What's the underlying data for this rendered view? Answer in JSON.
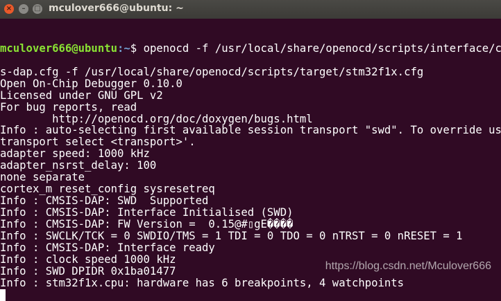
{
  "window": {
    "title": "mculover666@ubuntu: ~"
  },
  "prompt": {
    "user_host": "mculover666@ubuntu",
    "path": ":~",
    "symbol": "$ ",
    "command": "openocd -f /usr/local/share/openocd/scripts/interface/cmsi"
  },
  "lines": [
    "s-dap.cfg -f /usr/local/share/openocd/scripts/target/stm32f1x.cfg",
    "Open On-Chip Debugger 0.10.0",
    "Licensed under GNU GPL v2",
    "For bug reports, read",
    "        http://openocd.org/doc/doxygen/bugs.html",
    "Info : auto-selecting first available session transport \"swd\". To override use '",
    "transport select <transport>'.",
    "adapter speed: 1000 kHz",
    "adapter_nsrst_delay: 100",
    "none separate",
    "cortex_m reset_config sysresetreq",
    "Info : CMSIS-DAP: SWD  Supported",
    "Info : CMSIS-DAP: Interface Initialised (SWD)",
    "Info : CMSIS-DAP: FW Version =  0.15@#▯gE����",
    "Info : SWCLK/TCK = 0 SWDIO/TMS = 1 TDI = 0 TDO = 0 nTRST = 0 nRESET = 1",
    "Info : CMSIS-DAP: Interface ready",
    "Info : clock speed 1000 kHz",
    "Info : SWD DPIDR 0x1ba01477",
    "Info : stm32f1x.cpu: hardware has 6 breakpoints, 4 watchpoints"
  ],
  "watermark": "https://blog.csdn.net/Mculover666",
  "colors": {
    "background": "#300a24",
    "user": "#8ae234",
    "path": "#729fcf"
  }
}
